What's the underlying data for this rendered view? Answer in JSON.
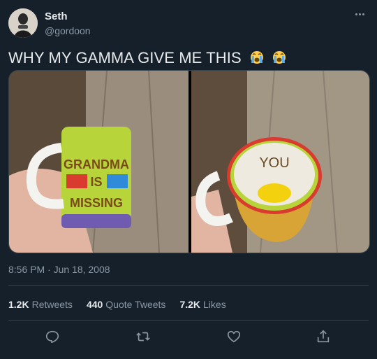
{
  "author": {
    "name": "Seth",
    "handle": "@gordoon",
    "avatar_icon": "avatar-photo"
  },
  "tweet": {
    "text": "WHY MY GAMMA GIVE ME THIS",
    "emoji": [
      "loudly-crying-face-icon",
      "loudly-crying-face-icon"
    ],
    "timestamp": "8:56 PM · Jun 18, 2008"
  },
  "media": {
    "left_image": {
      "description": "mug",
      "mug_text": [
        "GRANDMA",
        "IS",
        "MISSING"
      ]
    },
    "right_image": {
      "description": "mug-inside",
      "mug_text": [
        "YOU"
      ]
    }
  },
  "stats": {
    "retweets_count": "1.2K",
    "retweets_label": "Retweets",
    "quotes_count": "440",
    "quotes_label": "Quote Tweets",
    "likes_count": "7.2K",
    "likes_label": "Likes"
  },
  "actions": [
    "reply-icon",
    "retweet-icon",
    "like-icon",
    "share-icon"
  ],
  "colors": {
    "background": "#15202b",
    "text": "#e7e9ea",
    "secondary": "#8b98a5",
    "divider": "#38444d"
  }
}
